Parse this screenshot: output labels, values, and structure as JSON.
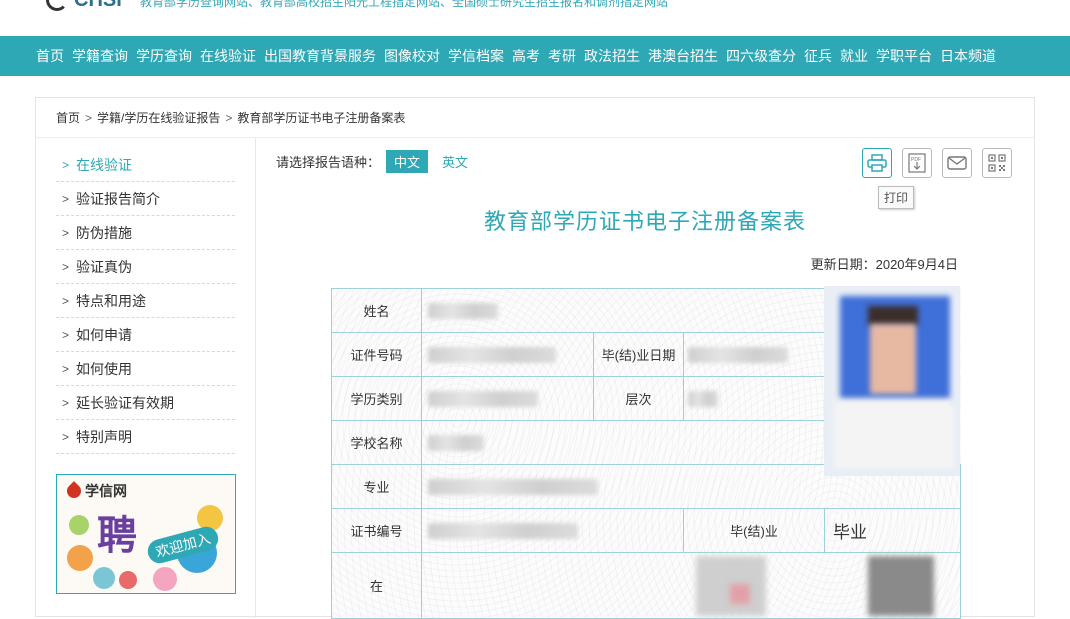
{
  "header": {
    "logo_text": "CHSI",
    "slogan": "教育部学历查询网站、教育部高校招生阳光工程指定网站、全国硕士研究生招生报名和调剂指定网站"
  },
  "nav": {
    "items": [
      "首页",
      "学籍查询",
      "学历查询",
      "在线验证",
      "出国教育背景服务",
      "图像校对",
      "学信档案",
      "高考",
      "考研",
      "政法招生",
      "港澳台招生",
      "四六级查分",
      "征兵",
      "就业",
      "学职平台",
      "日本频道"
    ]
  },
  "breadcrumb": {
    "home": "首页",
    "sep": ">",
    "level1": "学籍/学历在线验证报告",
    "current": "教育部学历证书电子注册备案表"
  },
  "sidebar": {
    "chevron": ">",
    "items": [
      {
        "label": "在线验证",
        "active": true
      },
      {
        "label": "验证报告简介",
        "active": false
      },
      {
        "label": "防伪措施",
        "active": false
      },
      {
        "label": "验证真伪",
        "active": false
      },
      {
        "label": "特点和用途",
        "active": false
      },
      {
        "label": "如何申请",
        "active": false
      },
      {
        "label": "如何使用",
        "active": false
      },
      {
        "label": "延长验证有效期",
        "active": false
      },
      {
        "label": "特别声明",
        "active": false
      }
    ],
    "promo": {
      "brand": "学信网",
      "big": "聘",
      "sub": "欢迎加入"
    }
  },
  "main": {
    "lang_prompt": "请选择报告语种：",
    "lang_options": [
      "中文",
      "英文"
    ],
    "selected_lang": "中文",
    "tools": [
      "print-icon",
      "pdf-download-icon",
      "mail-icon",
      "qrcode-icon"
    ],
    "tooltip": "打印",
    "doc_title": "教育部学历证书电子注册备案表",
    "update_date": "更新日期：2020年9月4日",
    "table": {
      "name_label": "姓名",
      "id_label": "证件号码",
      "grad_date_label": "毕(结)业日期",
      "edu_type_label": "学历类别",
      "level_label": "层次",
      "school_label": "学校名称",
      "major_label": "专业",
      "cert_no_label": "证书编号",
      "grad_label": "毕(结)业",
      "grad_value": "毕业",
      "at_label": "在"
    }
  },
  "colors": {
    "accent": "#2fa8b6",
    "nav_bg": "#2fa8b6",
    "table_border": "#9fd0d8",
    "promo_purple": "#6a3fa0"
  }
}
